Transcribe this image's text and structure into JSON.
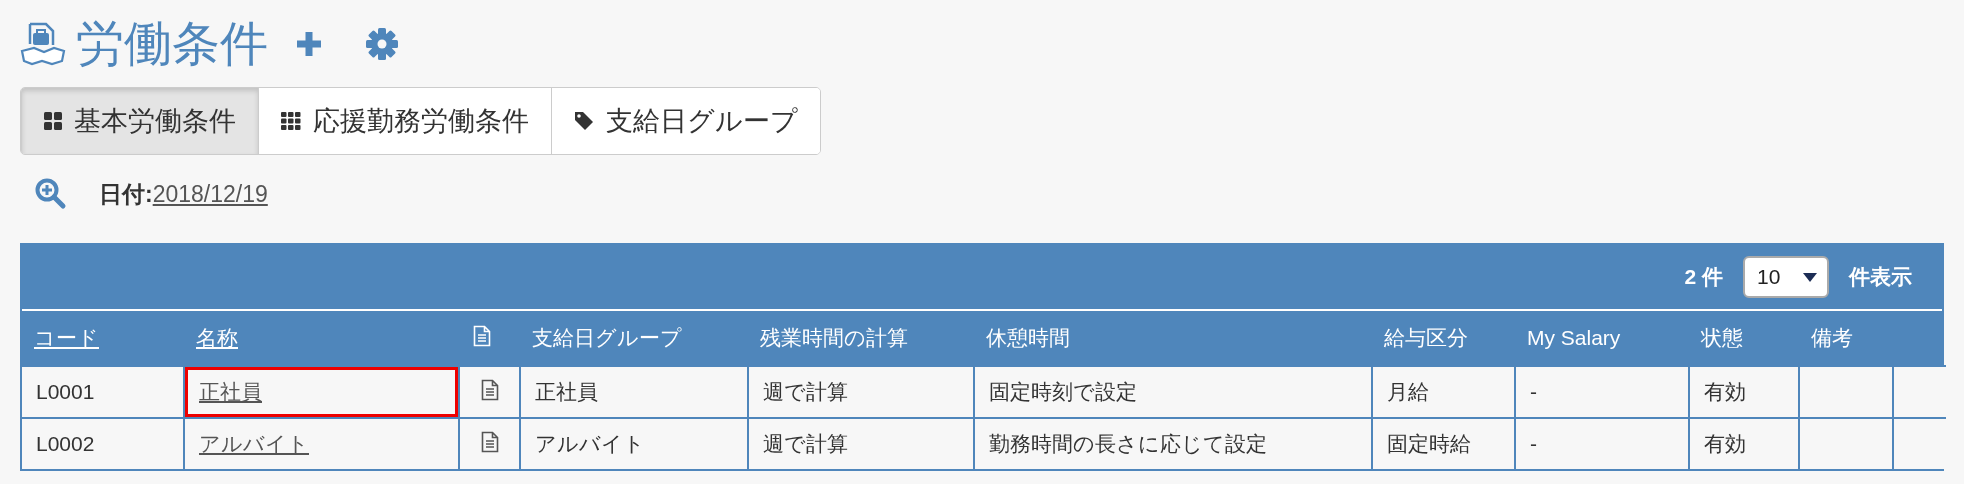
{
  "page": {
    "title": "労働条件"
  },
  "tabs": [
    {
      "label": "基本労働条件",
      "selected": true
    },
    {
      "label": "応援勤務労働条件",
      "selected": false
    },
    {
      "label": "支給日グループ",
      "selected": false
    }
  ],
  "filter": {
    "label": "日付:",
    "date": "2018/12/19"
  },
  "table": {
    "count": "2 件",
    "page_size": "10",
    "page_size_label": "件表示",
    "columns": [
      {
        "label": "コード",
        "kind": "link"
      },
      {
        "label": "名称",
        "kind": "link"
      },
      {
        "kind": "icon"
      },
      {
        "label": "支給日グループ",
        "kind": "text"
      },
      {
        "label": "残業時間の計算",
        "kind": "text"
      },
      {
        "label": "休憩時間",
        "kind": "text"
      },
      {
        "label": "給与区分",
        "kind": "text"
      },
      {
        "label": "My Salary",
        "kind": "text"
      },
      {
        "label": "状態",
        "kind": "text"
      },
      {
        "label": "備考",
        "kind": "text"
      }
    ],
    "rows": [
      {
        "code": "L0001",
        "name": "正社員",
        "name_highlighted": true,
        "pay_day_group": "正社員",
        "overtime_calc": "週で計算",
        "break_time": "固定時刻で設定",
        "salary_type": "月給",
        "my_salary": "-",
        "status": "有効"
      },
      {
        "code": "L0002",
        "name": "アルバイト",
        "name_highlighted": false,
        "pay_day_group": "アルバイト",
        "overtime_calc": "週で計算",
        "break_time": "勤務時間の長さに応じて設定",
        "salary_type": "固定時給",
        "my_salary": "-",
        "status": "有効"
      }
    ]
  }
}
